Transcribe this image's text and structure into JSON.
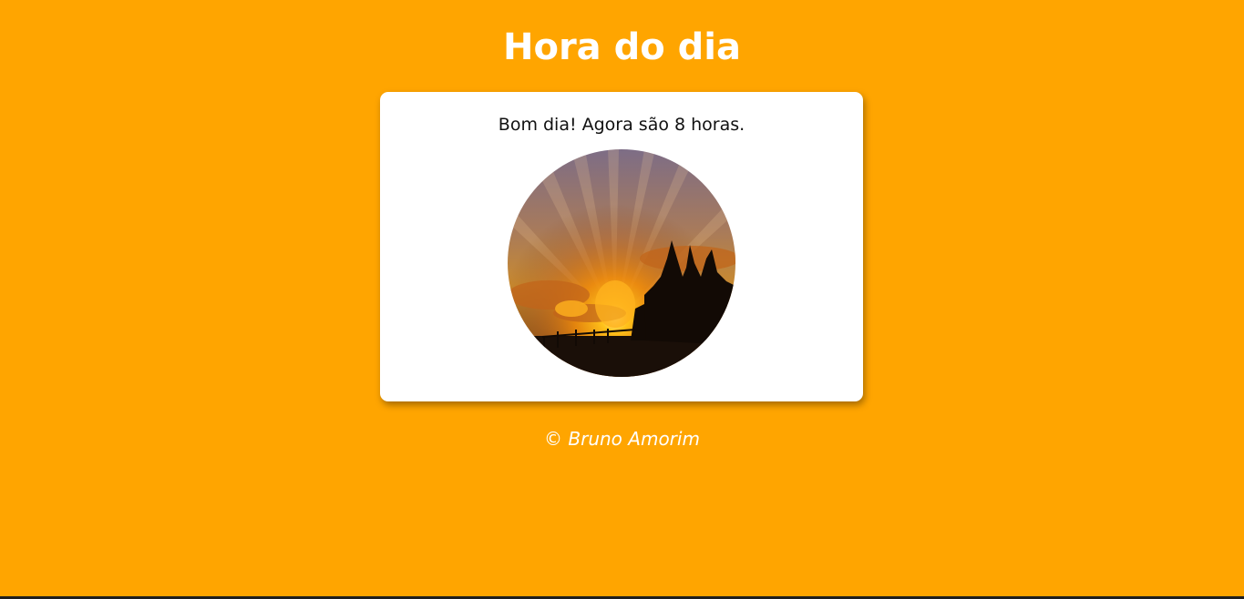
{
  "page": {
    "title": "Hora do dia",
    "background_color": "#FFA500"
  },
  "card": {
    "message": "Bom dia! Agora são 8 horas.",
    "image_icon": "sunrise-photo"
  },
  "footer": {
    "text": "© Bruno Amorim"
  }
}
